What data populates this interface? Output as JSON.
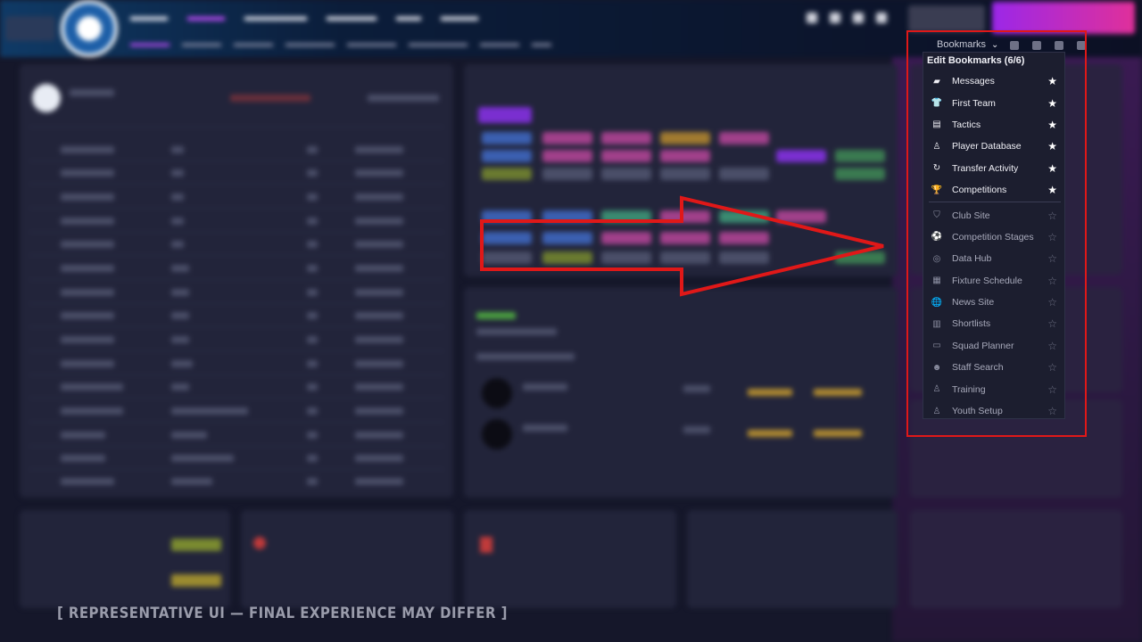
{
  "bookmarks": {
    "toggle_label": "Bookmarks",
    "title": "Edit Bookmarks (6/6)",
    "pinned": [
      {
        "label": "Messages",
        "icon": "chat-bubble-icon",
        "glyph": "▰"
      },
      {
        "label": "First Team",
        "icon": "shirt-icon",
        "glyph": "👕"
      },
      {
        "label": "Tactics",
        "icon": "tactics-board-icon",
        "glyph": "▤"
      },
      {
        "label": "Player Database",
        "icon": "player-database-icon",
        "glyph": "♙"
      },
      {
        "label": "Transfer Activity",
        "icon": "transfer-cycle-icon",
        "glyph": "↻"
      },
      {
        "label": "Competitions",
        "icon": "trophy-icon",
        "glyph": "🏆"
      }
    ],
    "unpinned": [
      {
        "label": "Club Site",
        "icon": "shield-icon",
        "glyph": "⛉"
      },
      {
        "label": "Competition Stages",
        "icon": "football-icon",
        "glyph": "⚽"
      },
      {
        "label": "Data Hub",
        "icon": "data-hub-icon",
        "glyph": "◎"
      },
      {
        "label": "Fixture Schedule",
        "icon": "calendar-grid-icon",
        "glyph": "▦"
      },
      {
        "label": "News Site",
        "icon": "globe-icon",
        "glyph": "🌐"
      },
      {
        "label": "Shortlists",
        "icon": "clipboard-icon",
        "glyph": "▥"
      },
      {
        "label": "Squad Planner",
        "icon": "squad-planner-icon",
        "glyph": "▭"
      },
      {
        "label": "Staff Search",
        "icon": "staff-search-icon",
        "glyph": "☻"
      },
      {
        "label": "Training",
        "icon": "training-icon",
        "glyph": "♙"
      },
      {
        "label": "Youth Setup",
        "icon": "youth-setup-icon",
        "glyph": "♙"
      }
    ],
    "star_filled": "★",
    "star_empty": "☆"
  },
  "watermark": "[ REPRESENTATIVE UI — FINAL EXPERIENCE MAY DIFFER ]",
  "colors": {
    "accent": "#c44dff",
    "highlight_red": "#e01818",
    "panel_bg": "#22243a",
    "dropdown_bg": "#1c1e2f"
  }
}
